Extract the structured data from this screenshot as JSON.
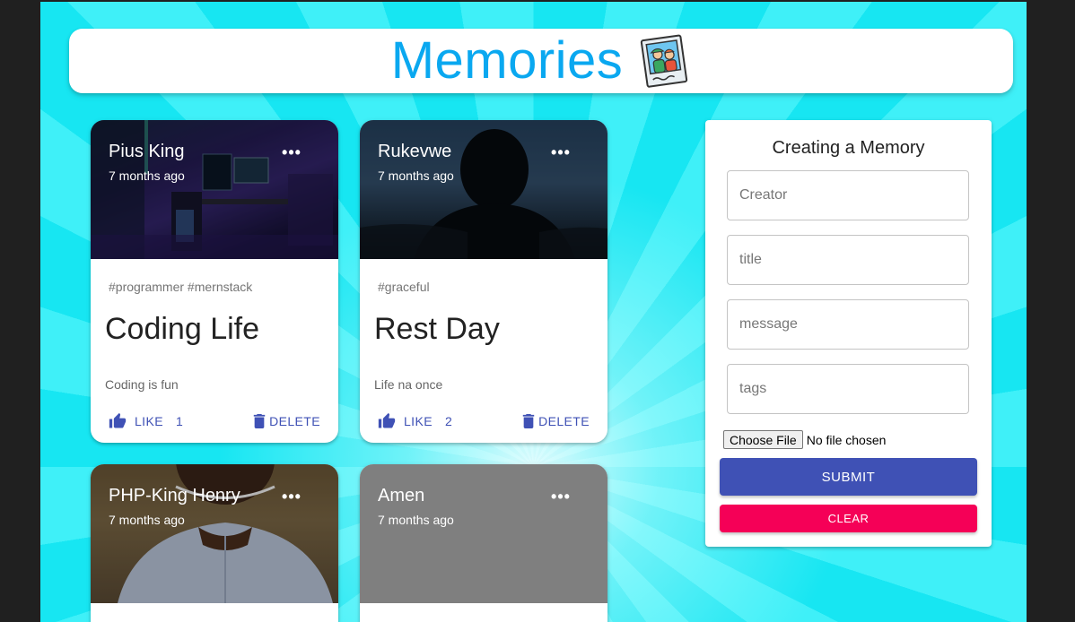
{
  "app": {
    "title": "Memories",
    "logo_icon": "photo-frame-icon",
    "brand_color": "#0aa8f0"
  },
  "posts": [
    {
      "creator": "Pius King",
      "time": "7 months ago",
      "tags": "#programmer #mernstack",
      "title": "Coding Life",
      "message": "Coding is fun",
      "like_label": "LIKE",
      "likes": "1",
      "delete_label": "DELETE",
      "image_desc_icon": "desk-setup-photo"
    },
    {
      "creator": "Rukevwe",
      "time": "7 months ago",
      "tags": "#graceful",
      "title": "Rest Day",
      "message": "Life na once",
      "like_label": "LIKE",
      "likes": "2",
      "delete_label": "DELETE",
      "image_desc_icon": "silhouette-photo"
    },
    {
      "creator": "PHP-King Henry",
      "time": "7 months ago",
      "image_desc_icon": "portrait-photo"
    },
    {
      "creator": "Amen",
      "time": "7 months ago",
      "image_desc_icon": "blank-photo"
    }
  ],
  "form": {
    "heading": "Creating a Memory",
    "fields": {
      "creator": {
        "placeholder": "Creator",
        "value": ""
      },
      "title": {
        "placeholder": "title",
        "value": ""
      },
      "message": {
        "placeholder": "message",
        "value": ""
      },
      "tags": {
        "placeholder": "tags",
        "value": ""
      }
    },
    "file_button": "Choose File",
    "file_status": "No file chosen",
    "submit_label": "SUBMIT",
    "clear_label": "CLEAR"
  },
  "colors": {
    "primary": "#3f51b5",
    "secondary": "#f50057",
    "background": "#17e6f2"
  }
}
